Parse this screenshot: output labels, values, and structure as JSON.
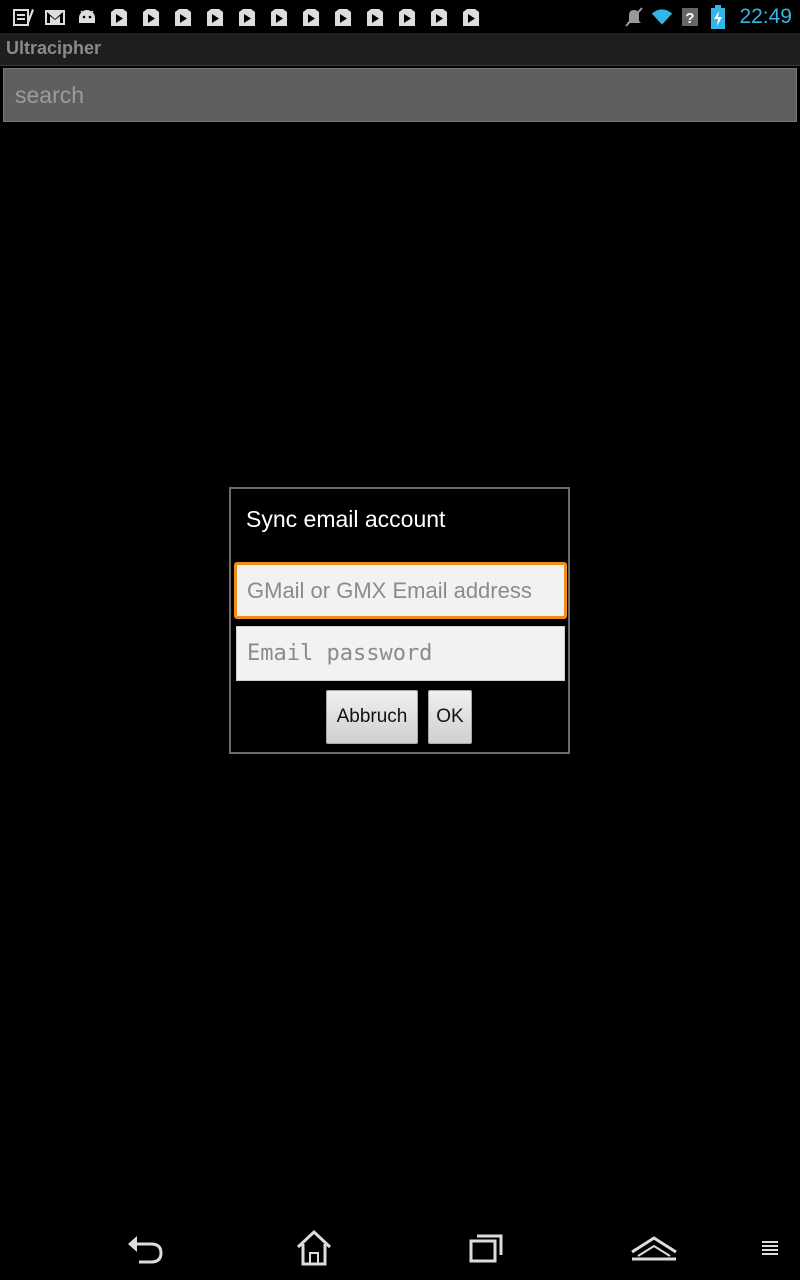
{
  "status_bar": {
    "time": "22:49",
    "left_icons": [
      "notes-icon",
      "gmail-icon",
      "android-icon",
      "play-store-icon",
      "play-store-icon",
      "play-store-icon",
      "play-store-icon",
      "play-store-icon",
      "play-store-icon",
      "play-store-icon",
      "play-store-icon",
      "play-store-icon",
      "play-store-icon",
      "play-store-icon",
      "play-store-icon"
    ],
    "right_icons": [
      "muted-icon",
      "wifi-icon",
      "signal-unknown-icon",
      "battery-charging-icon"
    ]
  },
  "app": {
    "title": "Ultracipher"
  },
  "search": {
    "placeholder": "search",
    "value": ""
  },
  "dialog": {
    "title": "Sync email account",
    "email_field": {
      "placeholder": "GMail or GMX Email address",
      "value": ""
    },
    "password_field": {
      "placeholder": "Email password",
      "value": ""
    },
    "cancel_label": "Abbruch",
    "ok_label": "OK"
  },
  "nav_bar": {
    "buttons": [
      "back-icon",
      "home-icon",
      "recent-apps-icon",
      "up-icon",
      "menu-icon"
    ]
  },
  "colors": {
    "accent_blue": "#33b5e5",
    "focus_orange": "#f08c1c",
    "background": "#000000"
  }
}
